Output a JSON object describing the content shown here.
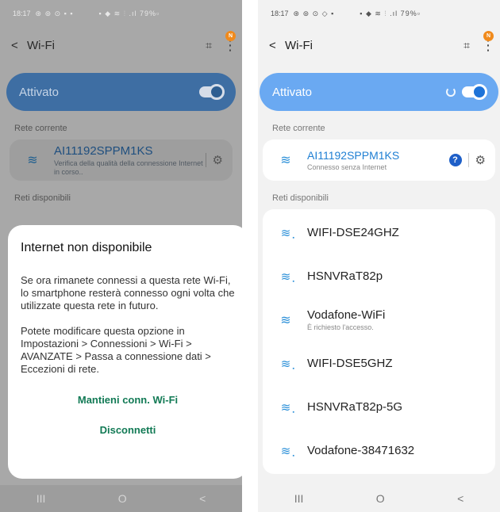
{
  "left": {
    "status": {
      "time": "18:17",
      "left_icons": "⊛ ⊚ ⊙ ▪ ▪",
      "right_icons": "▪ ◆ ≋ ⫶ .ıl 79%▫"
    },
    "header": {
      "title": "Wi-Fi",
      "badge": "N"
    },
    "toggle": {
      "label": "Attivato"
    },
    "current_section": "Rete corrente",
    "current_network": {
      "name": "AI11192SPPM1KS",
      "status": "Verifica della qualità della connessione Internet in corso.."
    },
    "available_section": "Reti disponibili",
    "dialog": {
      "title": "Internet non disponibile",
      "body1": "Se ora rimanete connessi a questa rete Wi-Fi, lo smartphone resterà connesso ogni volta che utilizzate questa rete in futuro.",
      "body2": "Potete modificare questa opzione in Impostazioni > Connessioni > Wi-Fi > AVANZATE > Passa a connessione dati > Eccezioni di rete.",
      "keep_button": "Mantieni conn. Wi-Fi",
      "disconnect_button": "Disconnetti"
    }
  },
  "right": {
    "status": {
      "time": "18:17",
      "left_icons": "⊛ ⊚ ⊙ ◇ ▪",
      "right_icons": "▪ ◆ ≋ ⫶ .ıl 79%▫"
    },
    "header": {
      "title": "Wi-Fi",
      "badge": "N"
    },
    "toggle": {
      "label": "Attivato"
    },
    "current_section": "Rete corrente",
    "current_network": {
      "name": "AI11192SPPM1KS",
      "status": "Connesso senza Internet"
    },
    "available_section": "Reti disponibili",
    "networks": [
      {
        "name": "WIFI-DSE24GHZ",
        "sub": "",
        "secured": true
      },
      {
        "name": "HSNVRaT82p",
        "sub": "",
        "secured": true
      },
      {
        "name": "Vodafone-WiFi",
        "sub": "È richiesto l'accesso.",
        "secured": false
      },
      {
        "name": "WIFI-DSE5GHZ",
        "sub": "",
        "secured": true
      },
      {
        "name": "HSNVRaT82p-5G",
        "sub": "",
        "secured": true
      },
      {
        "name": "Vodafone-38471632",
        "sub": "",
        "secured": true
      }
    ]
  },
  "nav": {
    "recents": "III",
    "home": "O",
    "back": "<"
  },
  "colors": {
    "accent": "#6aa9f2",
    "switch": "#1e73d8",
    "dialog_button": "#127a55"
  }
}
